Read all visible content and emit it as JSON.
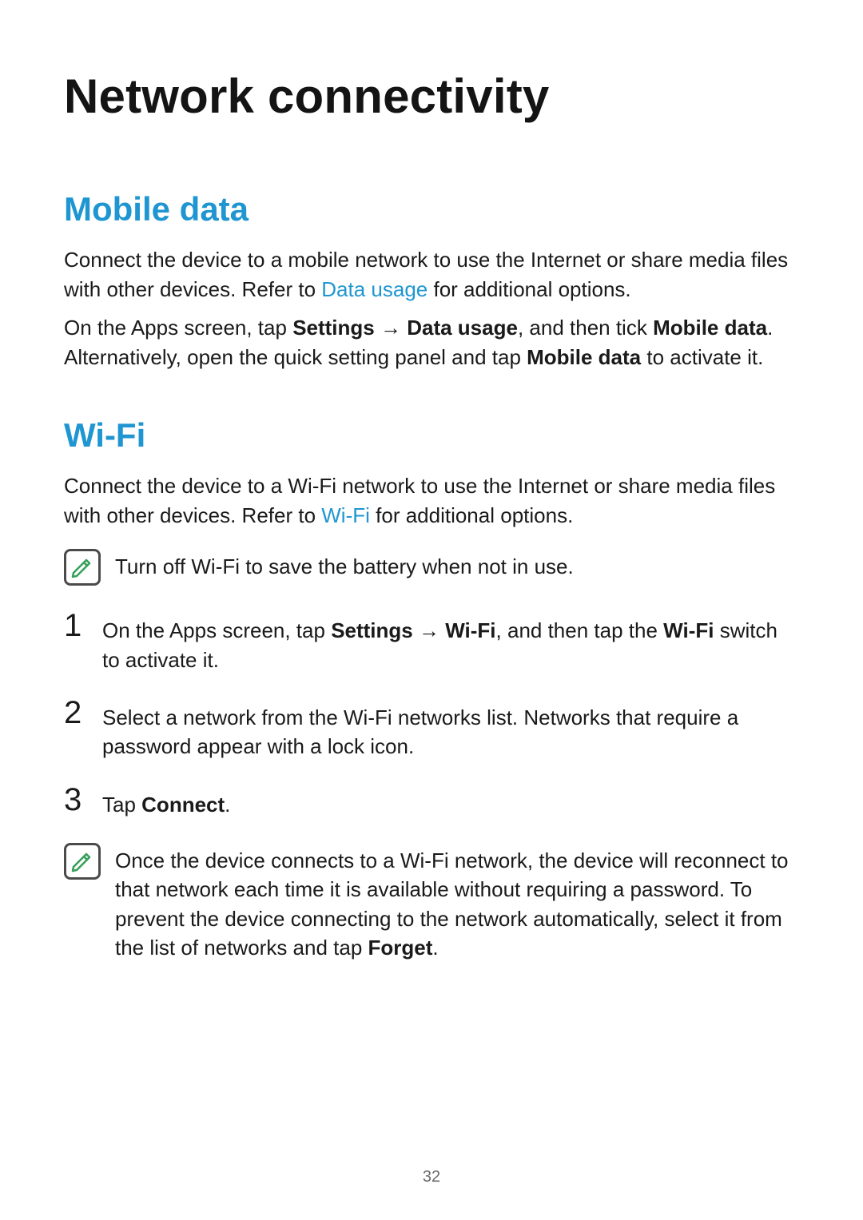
{
  "page": {
    "title": "Network connectivity",
    "number": "32"
  },
  "sections": {
    "mobile_data": {
      "heading": "Mobile data",
      "p1_pre": "Connect the device to a mobile network to use the Internet or share media files with other devices. Refer to ",
      "p1_link": "Data usage",
      "p1_post": " for additional options.",
      "p2_a": "On the Apps screen, tap ",
      "p2_settings": "Settings",
      "p2_arrow": " → ",
      "p2_datausage": "Data usage",
      "p2_b": ", and then tick ",
      "p2_mobiledata": "Mobile data",
      "p2_c": ". Alternatively, open the quick setting panel and tap ",
      "p2_mobiledata2": "Mobile data",
      "p2_d": " to activate it."
    },
    "wifi": {
      "heading": "Wi-Fi",
      "p1_pre": "Connect the device to a Wi-Fi network to use the Internet or share media files with other devices. Refer to ",
      "p1_link": "Wi-Fi",
      "p1_post": " for additional options.",
      "note1": "Turn off Wi-Fi to save the battery when not in use.",
      "steps": {
        "n1": "1",
        "s1_a": "On the Apps screen, tap ",
        "s1_settings": "Settings",
        "s1_arrow": " → ",
        "s1_wifi": "Wi-Fi",
        "s1_b": ", and then tap the ",
        "s1_wifi2": "Wi-Fi",
        "s1_c": " switch to activate it.",
        "n2": "2",
        "s2": "Select a network from the Wi-Fi networks list. Networks that require a password appear with a lock icon.",
        "n3": "3",
        "s3_a": "Tap ",
        "s3_connect": "Connect",
        "s3_b": "."
      },
      "note2_a": "Once the device connects to a Wi-Fi network, the device will reconnect to that network each time it is available without requiring a password. To prevent the device connecting to the network automatically, select it from the list of networks and tap ",
      "note2_forget": "Forget",
      "note2_b": "."
    }
  },
  "icons": {
    "note": "note-icon"
  }
}
